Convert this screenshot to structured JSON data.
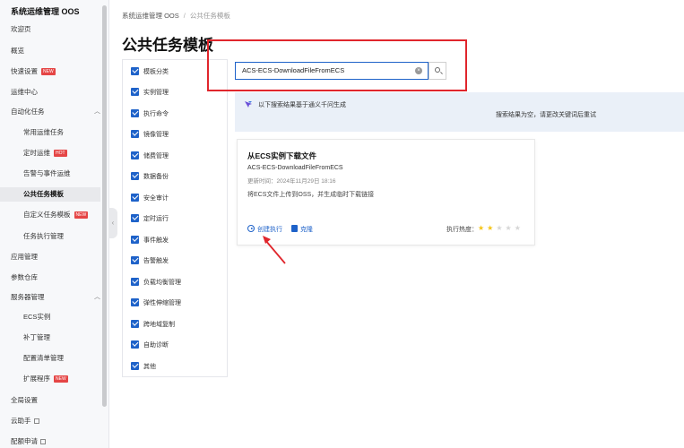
{
  "app": {
    "title": "系统运维管理 OOS"
  },
  "sidebar": {
    "items": [
      {
        "label": "欢迎页"
      },
      {
        "label": "概览"
      },
      {
        "label": "快速设置",
        "badge": "NEW"
      },
      {
        "label": "运维中心"
      },
      {
        "label": "自动化任务"
      },
      {
        "label": "常用运维任务"
      },
      {
        "label": "定时运维",
        "badge": "HOT"
      },
      {
        "label": "告警与事件运维"
      },
      {
        "label": "公共任务模板"
      },
      {
        "label": "自定义任务模板",
        "badge": "NEW"
      },
      {
        "label": "任务执行管理"
      },
      {
        "label": "应用管理"
      },
      {
        "label": "参数仓库"
      },
      {
        "label": "服务器管理"
      },
      {
        "label": "ECS实例"
      },
      {
        "label": "补丁管理"
      },
      {
        "label": "配置清单管理"
      },
      {
        "label": "扩展程序",
        "badge": "NEW"
      },
      {
        "label": "全局设置"
      },
      {
        "label": "云助手"
      },
      {
        "label": "配额申请"
      }
    ],
    "active_item": "公共任务模板"
  },
  "header": {
    "breadcrumb": [
      "系统运维管理 OOS",
      "公共任务模板"
    ],
    "page_title": "公共任务模板"
  },
  "filters": [
    {
      "label": "模板分类",
      "checked": true
    },
    {
      "label": "实例管理",
      "checked": true
    },
    {
      "label": "执行命令",
      "checked": true
    },
    {
      "label": "镜像管理",
      "checked": true
    },
    {
      "label": "储费管理",
      "checked": true
    },
    {
      "label": "数据备份",
      "checked": true
    },
    {
      "label": "安全审计",
      "checked": true
    },
    {
      "label": "定时运行",
      "checked": true
    },
    {
      "label": "事件触发",
      "checked": true
    },
    {
      "label": "告警触发",
      "checked": true
    },
    {
      "label": "负载均衡管理",
      "checked": true
    },
    {
      "label": "弹性伸缩管理",
      "checked": true
    },
    {
      "label": "跨地域复制",
      "checked": true
    },
    {
      "label": "自助诊断",
      "checked": true
    },
    {
      "label": "其他",
      "checked": true
    }
  ],
  "search": {
    "value": "ACS-ECS-DownloadFileFromECS"
  },
  "notice": {
    "title": "以下搜索结果基于通义千问生成",
    "subtitle": "搜索结果为空，请更改关键词后重试"
  },
  "card": {
    "title": "从ECS实例下载文件",
    "name": "ACS-ECS-DownloadFileFromECS",
    "updated": "更新时间：2024年11月29日 18:16",
    "description": "将ECS文件上传到OSS，并生成临时下载链接",
    "create_exec_label": "创建执行",
    "clone_label": "克隆",
    "heat_label": "执行热度：",
    "heat_rating": 2,
    "heat_max": 5
  },
  "colors": {
    "primary": "#1e62c9",
    "annotation": "#e0262c",
    "badge": "#e54545"
  }
}
